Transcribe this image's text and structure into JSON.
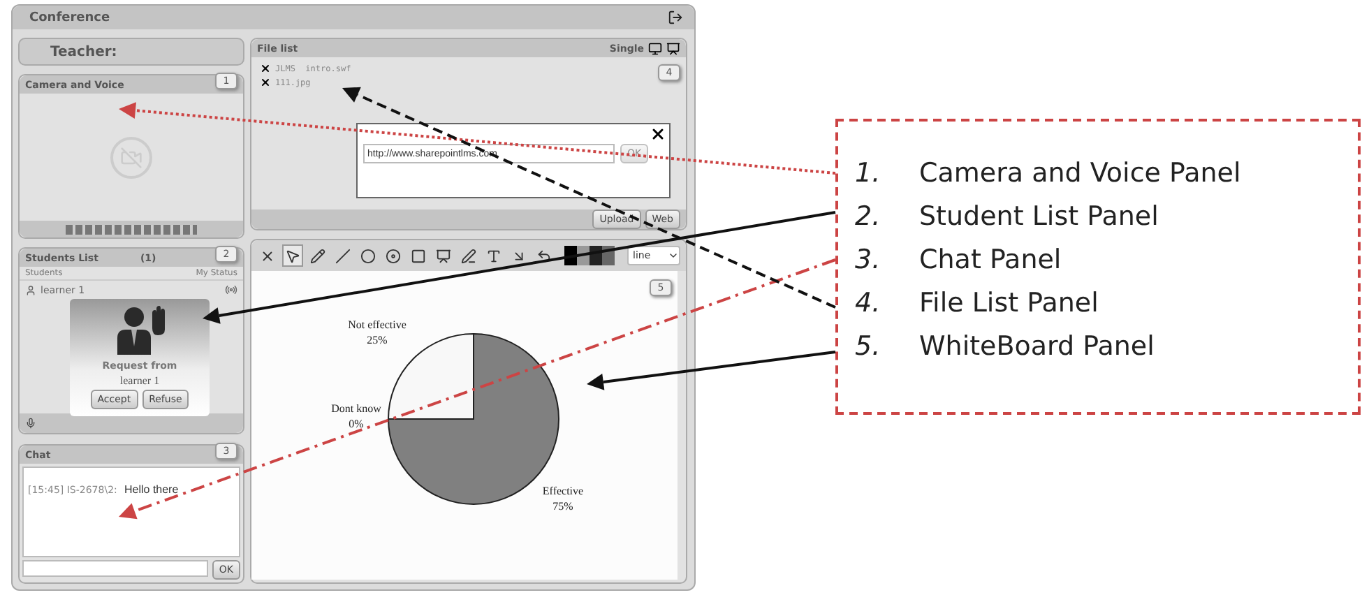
{
  "window": {
    "title": "Conference"
  },
  "teacher": {
    "label": "Teacher:"
  },
  "camera_panel": {
    "title": "Camera and Voice",
    "badge": "1"
  },
  "students_panel": {
    "title": "Students List",
    "count": "(1)",
    "badge": "2",
    "columns": [
      "Students",
      "My Status"
    ],
    "rows": [
      {
        "name": "learner 1"
      }
    ],
    "request": {
      "title": "Request from",
      "name": "learner 1",
      "buttons": [
        "Accept",
        "Refuse"
      ]
    }
  },
  "chat_panel": {
    "title": "Chat",
    "badge": "3",
    "messages": [
      {
        "meta": "[15:45] IS-2678\\2:",
        "text": "Hello there"
      }
    ],
    "send_button": "OK"
  },
  "file_panel": {
    "title": "File list",
    "mode": "Single",
    "badge": "4",
    "files": [
      "JLMS  intro.swf",
      "111.jpg"
    ],
    "dialog": {
      "value": "http://www.sharepointlms.com",
      "button": "OK"
    },
    "buttons": [
      "Upload",
      "Web"
    ]
  },
  "whiteboard": {
    "badge": "5",
    "line_style": "line",
    "chart_data": {
      "type": "pie",
      "categories": [
        "Effective",
        "Not effective",
        "Dont know"
      ],
      "values": [
        75,
        25,
        0
      ],
      "data_labels": true,
      "value_labels": [
        "75%",
        "25%",
        "0%"
      ]
    }
  },
  "annotations": [
    {
      "number": "1.",
      "label": "Camera and Voice Panel"
    },
    {
      "number": "2.",
      "label": "Student List Panel"
    },
    {
      "number": "3.",
      "label": "Chat Panel"
    },
    {
      "number": "4.",
      "label": "File List Panel"
    },
    {
      "number": "5.",
      "label": "WhiteBoard Panel"
    }
  ]
}
